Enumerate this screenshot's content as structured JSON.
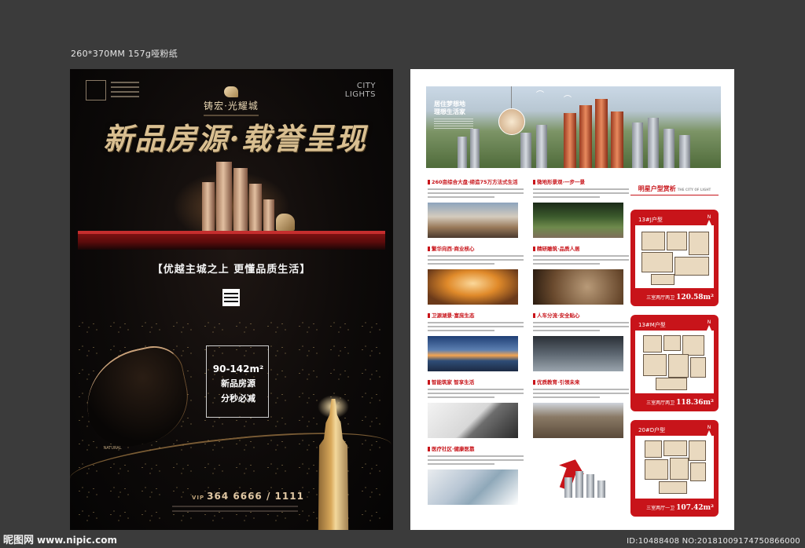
{
  "spec_text": "260*370MM   157g哑粉纸",
  "front": {
    "brand": "铸宏·光耀城",
    "city_lights": [
      "CITY",
      "LIGHTS"
    ],
    "headline": "新品房源·载誉呈现",
    "slogan": "【优越主城之上 更懂品质生活】",
    "box": {
      "area": "90-142m²",
      "t1": "新品房源",
      "t2": "分秒必减"
    },
    "natural": "NATURAL",
    "hotline_label": "VIP",
    "hotline": "364 6666 / 1111"
  },
  "back": {
    "hero_tag": [
      "居住梦想地",
      "理想生活家"
    ],
    "sections_left": [
      {
        "title": "260亩综合大盘·缔造75万方法式生活",
        "img": "img-a"
      },
      {
        "title": "繁华向西·商业核心",
        "img": "img-b"
      },
      {
        "title": "卫源湖景·富庶生态",
        "img": "img-c"
      },
      {
        "title": "智能筑家 智享生活",
        "img": "img-d"
      },
      {
        "title": "医疗社区·健康医靠",
        "img": "img-e"
      }
    ],
    "sections_right": [
      {
        "title": "微地形景观·一步一景",
        "img": "img-f"
      },
      {
        "title": "精研雕筑·品质人居",
        "img": "img-g"
      },
      {
        "title": "人车分流·安全贴心",
        "img": "img-h"
      },
      {
        "title": "优质教育·引领未来",
        "img": "img-i"
      }
    ],
    "plans_title": "明星户型赏析",
    "plans_title_small": "THE CITY OF LIGHT",
    "north": "N",
    "plans": [
      {
        "name": "13#J户型",
        "desc": "三室两厅两卫",
        "area": "120.58m²"
      },
      {
        "name": "13#M户型",
        "desc": "三室两厅两卫",
        "area": "118.36m²"
      },
      {
        "name": "20#D户型",
        "desc": "三室两厅一卫",
        "area": "107.42m²"
      }
    ]
  },
  "watermark": {
    "left": "昵图网",
    "site": "www.nipic.com",
    "right": "ID:10488408 NO:20181009174750866000"
  }
}
